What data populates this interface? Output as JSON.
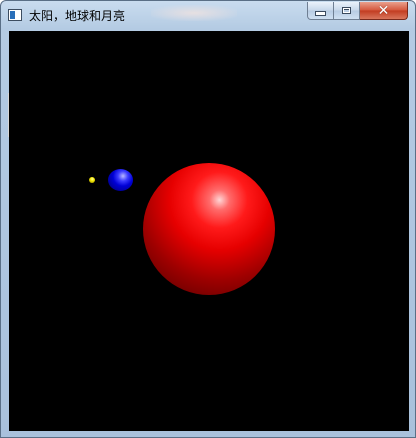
{
  "window": {
    "title": "太阳，地球和月亮",
    "controls": {
      "minimize_icon": "minimize-icon",
      "maximize_icon": "maximize-icon",
      "close_icon": "close-icon",
      "close_glyph": "✕"
    },
    "colors": {
      "close_button": "#c23b20",
      "client_background": "#000000"
    }
  },
  "scene": {
    "bodies": [
      {
        "name_icon": "sun-sphere",
        "color": "#ff0000"
      },
      {
        "name_icon": "earth-sphere",
        "color": "#0000ff"
      },
      {
        "name_icon": "moon-sphere",
        "color": "#ffff00"
      }
    ]
  }
}
